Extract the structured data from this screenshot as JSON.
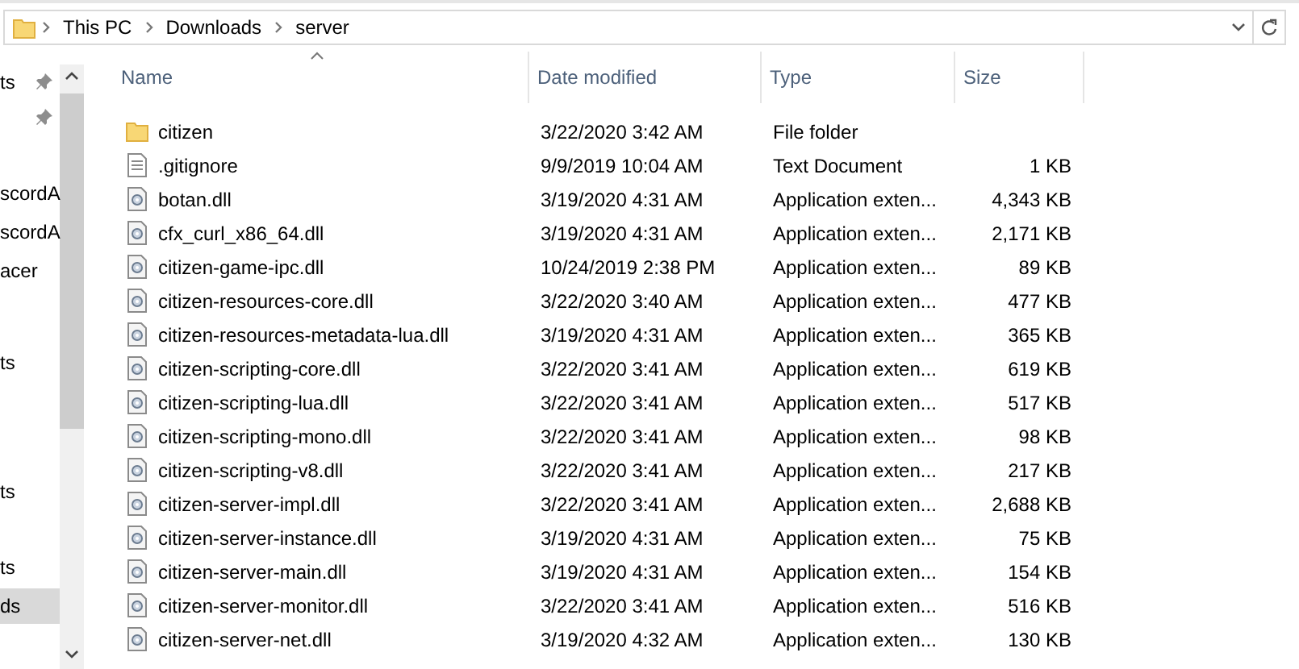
{
  "address_bar": {
    "breadcrumbs": [
      "This PC",
      "Downloads",
      "server"
    ]
  },
  "navigation_pane": {
    "items": [
      {
        "label": "ts",
        "pinned": true,
        "selected": false
      },
      {
        "pinned": true,
        "selected": false
      },
      {
        "label": "scordA",
        "pinned": false,
        "selected": false
      },
      {
        "label": "scordA",
        "pinned": false,
        "selected": false
      },
      {
        "label": "acer",
        "pinned": false,
        "selected": false
      },
      {
        "label": "ts",
        "pinned": false,
        "selected": false
      },
      {
        "label": "ts",
        "pinned": false,
        "selected": false
      },
      {
        "label": "ts",
        "pinned": false,
        "selected": false
      },
      {
        "label": "ds",
        "pinned": false,
        "selected": true
      }
    ]
  },
  "file_list": {
    "columns": [
      {
        "label": "Name",
        "sorted": true
      },
      {
        "label": "Date modified",
        "sorted": false
      },
      {
        "label": "Type",
        "sorted": false
      },
      {
        "label": "Size",
        "sorted": false
      }
    ],
    "rows": [
      {
        "kind": "folder",
        "name": "citizen",
        "date": "3/22/2020 3:42 AM",
        "type": "File folder"
      },
      {
        "kind": "text",
        "name": ".gitignore",
        "date": "9/9/2019 10:04 AM",
        "type": "Text Document",
        "size": "1 KB"
      },
      {
        "kind": "dll",
        "name": "botan.dll",
        "date": "3/19/2020 4:31 AM",
        "type": "Application exten...",
        "size": "4,343 KB"
      },
      {
        "kind": "dll",
        "name": "cfx_curl_x86_64.dll",
        "date": "3/19/2020 4:31 AM",
        "type": "Application exten...",
        "size": "2,171 KB"
      },
      {
        "kind": "dll",
        "name": "citizen-game-ipc.dll",
        "date": "10/24/2019 2:38 PM",
        "type": "Application exten...",
        "size": "89 KB"
      },
      {
        "kind": "dll",
        "name": "citizen-resources-core.dll",
        "date": "3/22/2020 3:40 AM",
        "type": "Application exten...",
        "size": "477 KB"
      },
      {
        "kind": "dll",
        "name": "citizen-resources-metadata-lua.dll",
        "date": "3/19/2020 4:31 AM",
        "type": "Application exten...",
        "size": "365 KB"
      },
      {
        "kind": "dll",
        "name": "citizen-scripting-core.dll",
        "date": "3/22/2020 3:41 AM",
        "type": "Application exten...",
        "size": "619 KB"
      },
      {
        "kind": "dll",
        "name": "citizen-scripting-lua.dll",
        "date": "3/22/2020 3:41 AM",
        "type": "Application exten...",
        "size": "517 KB"
      },
      {
        "kind": "dll",
        "name": "citizen-scripting-mono.dll",
        "date": "3/22/2020 3:41 AM",
        "type": "Application exten...",
        "size": "98 KB"
      },
      {
        "kind": "dll",
        "name": "citizen-scripting-v8.dll",
        "date": "3/22/2020 3:41 AM",
        "type": "Application exten...",
        "size": "217 KB"
      },
      {
        "kind": "dll",
        "name": "citizen-server-impl.dll",
        "date": "3/22/2020 3:41 AM",
        "type": "Application exten...",
        "size": "2,688 KB"
      },
      {
        "kind": "dll",
        "name": "citizen-server-instance.dll",
        "date": "3/19/2020 4:31 AM",
        "type": "Application exten...",
        "size": "75 KB"
      },
      {
        "kind": "dll",
        "name": "citizen-server-main.dll",
        "date": "3/19/2020 4:31 AM",
        "type": "Application exten...",
        "size": "154 KB"
      },
      {
        "kind": "dll",
        "name": "citizen-server-monitor.dll",
        "date": "3/22/2020 3:41 AM",
        "type": "Application exten...",
        "size": "516 KB"
      },
      {
        "kind": "dll",
        "name": "citizen-server-net.dll",
        "date": "3/19/2020 4:32 AM",
        "type": "Application exten...",
        "size": "130 KB"
      }
    ]
  }
}
